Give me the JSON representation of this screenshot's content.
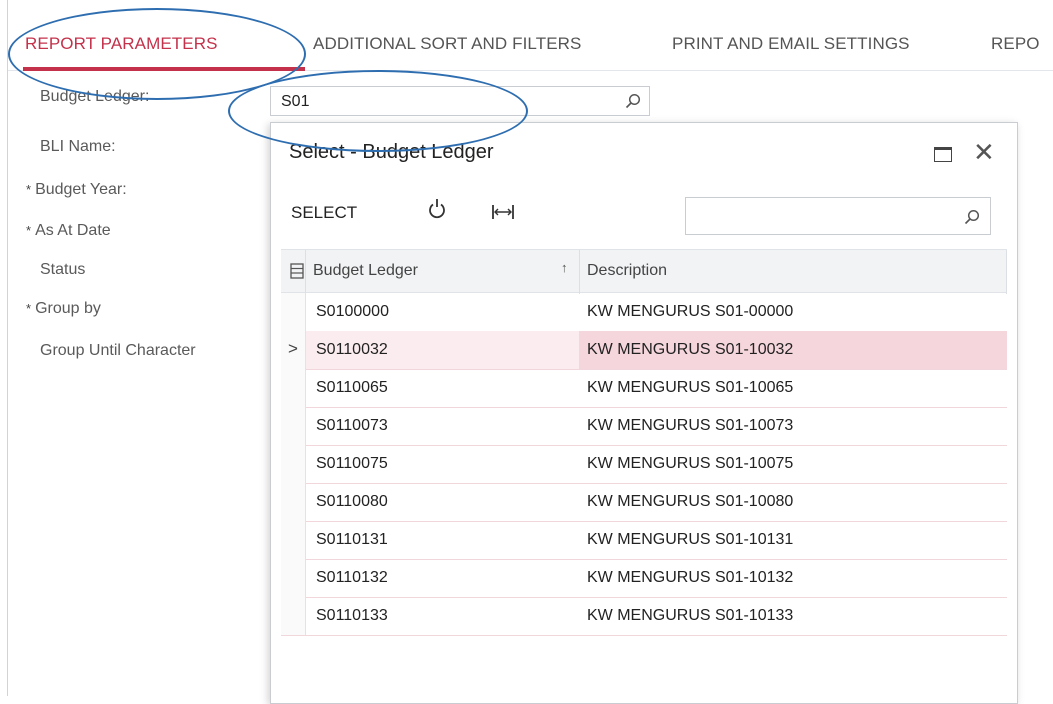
{
  "tabs": [
    {
      "label": "REPORT PARAMETERS",
      "active": true
    },
    {
      "label": "ADDITIONAL SORT AND FILTERS",
      "active": false
    },
    {
      "label": "PRINT AND EMAIL SETTINGS",
      "active": false
    },
    {
      "label": "REPO",
      "active": false
    }
  ],
  "form": {
    "labels": {
      "budget_ledger": "Budget Ledger:",
      "bli_name": "BLI Name:",
      "budget_year": "Budget Year:",
      "as_at_date": "As At Date",
      "status": "Status",
      "group_by": "Group by",
      "group_until_character": "Group Until Character"
    },
    "required_mark": "*",
    "budget_ledger_value": "S01"
  },
  "dialog": {
    "title": "Select - Budget Ledger",
    "toolbar": {
      "select_label": "SELECT"
    },
    "search_value": "",
    "columns": {
      "budget_ledger": "Budget Ledger",
      "sort_indicator": "↑",
      "description": "Description"
    },
    "active_row_marker": ">",
    "rows": [
      {
        "budget_ledger": "S0100000",
        "description": "KW MENGURUS S01-00000",
        "active": false
      },
      {
        "budget_ledger": "S0110032",
        "description": "KW MENGURUS S01-10032",
        "active": true
      },
      {
        "budget_ledger": "S0110065",
        "description": "KW MENGURUS S01-10065",
        "active": false
      },
      {
        "budget_ledger": "S0110073",
        "description": "KW MENGURUS S01-10073",
        "active": false
      },
      {
        "budget_ledger": "S0110075",
        "description": "KW MENGURUS S01-10075",
        "active": false
      },
      {
        "budget_ledger": "S0110080",
        "description": "KW MENGURUS S01-10080",
        "active": false
      },
      {
        "budget_ledger": "S0110131",
        "description": "KW MENGURUS S01-10131",
        "active": false
      },
      {
        "budget_ledger": "S0110132",
        "description": "KW MENGURUS S01-10132",
        "active": false
      },
      {
        "budget_ledger": "S0110133",
        "description": "KW MENGURUS S01-10133",
        "active": false
      }
    ]
  },
  "colors": {
    "accent": "#c4314b",
    "active_row": "#fbecef",
    "active_cell": "#f5d6dc",
    "annotation": "#2e6eb0"
  },
  "icons": [
    "search-icon",
    "refresh-icon",
    "fit-columns-icon",
    "maximize-icon",
    "close-icon",
    "column-chooser-icon",
    "row-pointer-icon"
  ]
}
